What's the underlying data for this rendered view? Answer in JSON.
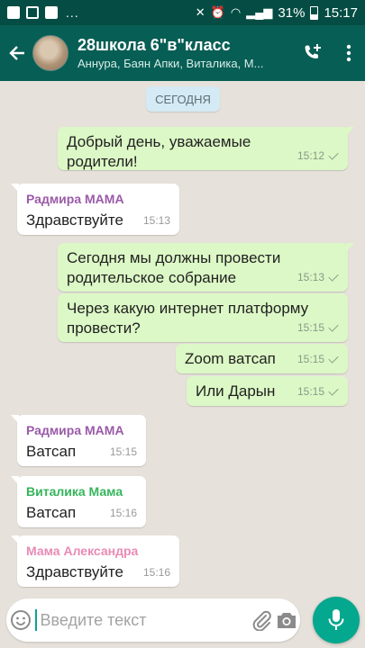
{
  "status_bar": {
    "battery": "31%",
    "time": "15:17",
    "more": "..."
  },
  "header": {
    "title": "28школа 6\"в\"класс",
    "subtitle": "Аннура, Баян Апки, Виталика, М..."
  },
  "date_divider": "СЕГОДНЯ",
  "messages": [
    {
      "text": "Добрый день, уважаемые родители!",
      "time": "15:12"
    },
    {
      "sender": "Радмира МАМА",
      "text": "Здравствуйте",
      "time": "15:13"
    },
    {
      "text": "Сегодня мы должны провести родительское собрание",
      "time": "15:13"
    },
    {
      "text": "Через какую интернет платформу провести?",
      "time": "15:15"
    },
    {
      "text": "Zoom ватсап",
      "time": "15:15"
    },
    {
      "text": "Или Дарын",
      "time": "15:15"
    },
    {
      "sender": "Радмира МАМА",
      "text": "Ватсап",
      "time": "15:15"
    },
    {
      "sender": "Виталика Мама",
      "text": "Ватсап",
      "time": "15:16"
    },
    {
      "sender": "Мама Александра",
      "text": "Здравствуйте",
      "time": "15:16"
    }
  ],
  "input": {
    "placeholder": "Введите текст"
  },
  "colors": {
    "app_bar": "#075e54",
    "outgoing_bubble": "#dcf8c6",
    "sender_radmira": "#9b5aa8",
    "sender_vitalika": "#35b55a",
    "sender_alexandra": "#e88bb5",
    "accent": "#03a88f"
  }
}
